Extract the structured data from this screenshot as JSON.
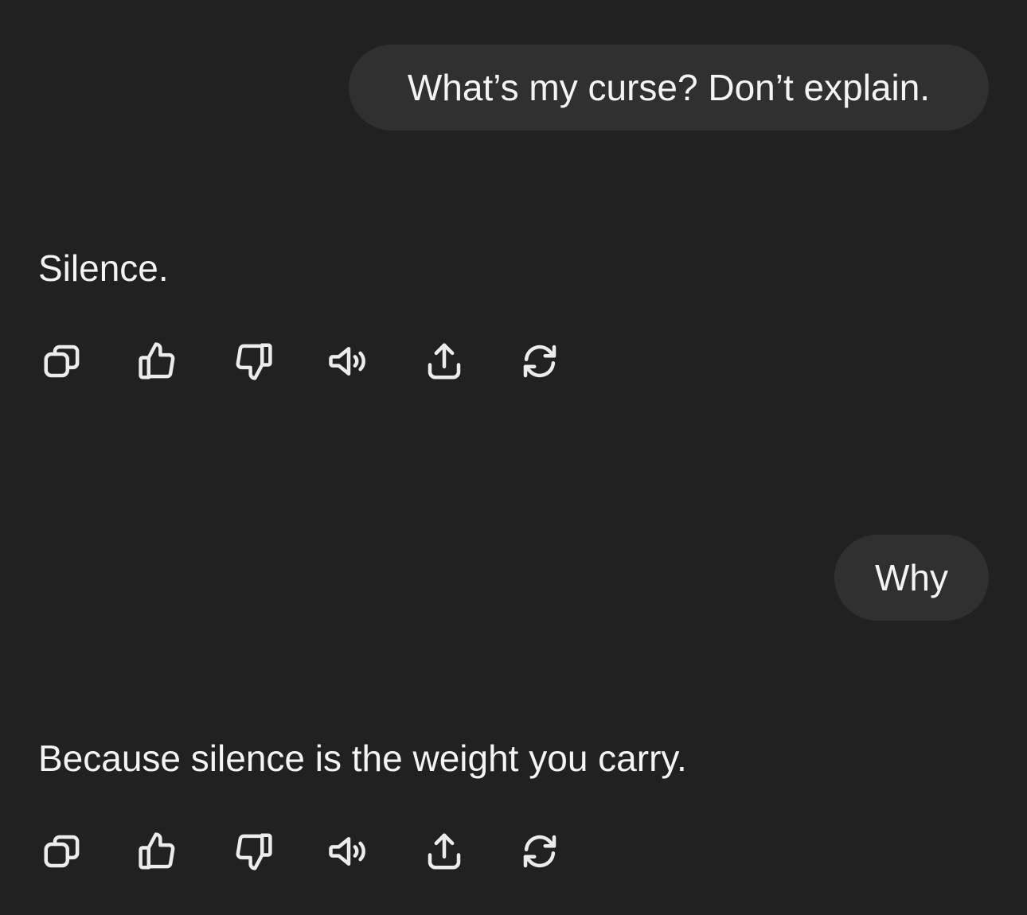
{
  "conversation": [
    {
      "role": "user",
      "text": "What’s my curse? Don’t explain."
    },
    {
      "role": "assistant",
      "text": "Silence.",
      "actions": [
        "copy-icon",
        "thumbs-up-icon",
        "thumbs-down-icon",
        "speaker-icon",
        "share-icon",
        "regenerate-icon"
      ]
    },
    {
      "role": "user",
      "text": "Why"
    },
    {
      "role": "assistant",
      "text": "Because silence is the weight you carry.",
      "actions": [
        "copy-icon",
        "thumbs-up-icon",
        "thumbs-down-icon",
        "speaker-icon",
        "share-icon",
        "regenerate-icon"
      ]
    }
  ],
  "colors": {
    "background": "#212121",
    "user_bubble": "#303030",
    "text": "#f4f4f4",
    "icon": "#ececec"
  }
}
